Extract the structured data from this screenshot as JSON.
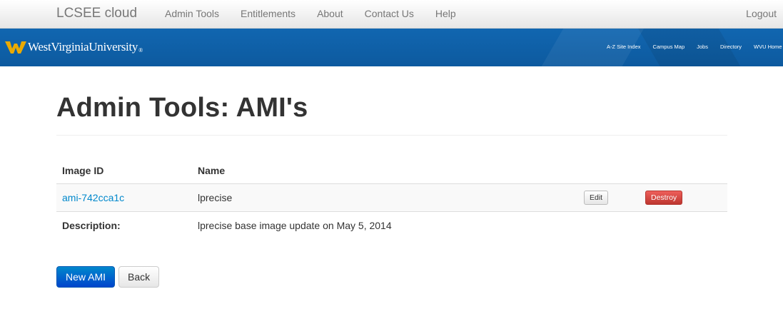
{
  "navbar": {
    "brand": "LCSEE cloud",
    "links": [
      "Admin Tools",
      "Entitlements",
      "About",
      "Contact Us",
      "Help"
    ],
    "logout": "Logout"
  },
  "banner": {
    "university_name": "WestVirginiaUniversity",
    "reg_mark": "®",
    "links": [
      "A-Z Site Index",
      "Campus Map",
      "Jobs",
      "Directory",
      "WVU Home"
    ],
    "colors": {
      "banner_blue": "#0f5fa6",
      "logo_gold": "#eaaa00"
    }
  },
  "page": {
    "title": "Admin Tools: AMI's"
  },
  "table": {
    "headers": {
      "image_id": "Image ID",
      "name": "Name"
    },
    "row": {
      "image_id": "ami-742cca1c",
      "name": "lprecise",
      "edit_label": "Edit",
      "destroy_label": "Destroy"
    },
    "description": {
      "label": "Description:",
      "value": "lprecise base image update on May 5, 2014"
    }
  },
  "actions": {
    "new_label": "New AMI",
    "back_label": "Back"
  },
  "colors": {
    "link": "#0088cc",
    "primary_button": "#0044cc",
    "danger_button": "#bd362f"
  }
}
